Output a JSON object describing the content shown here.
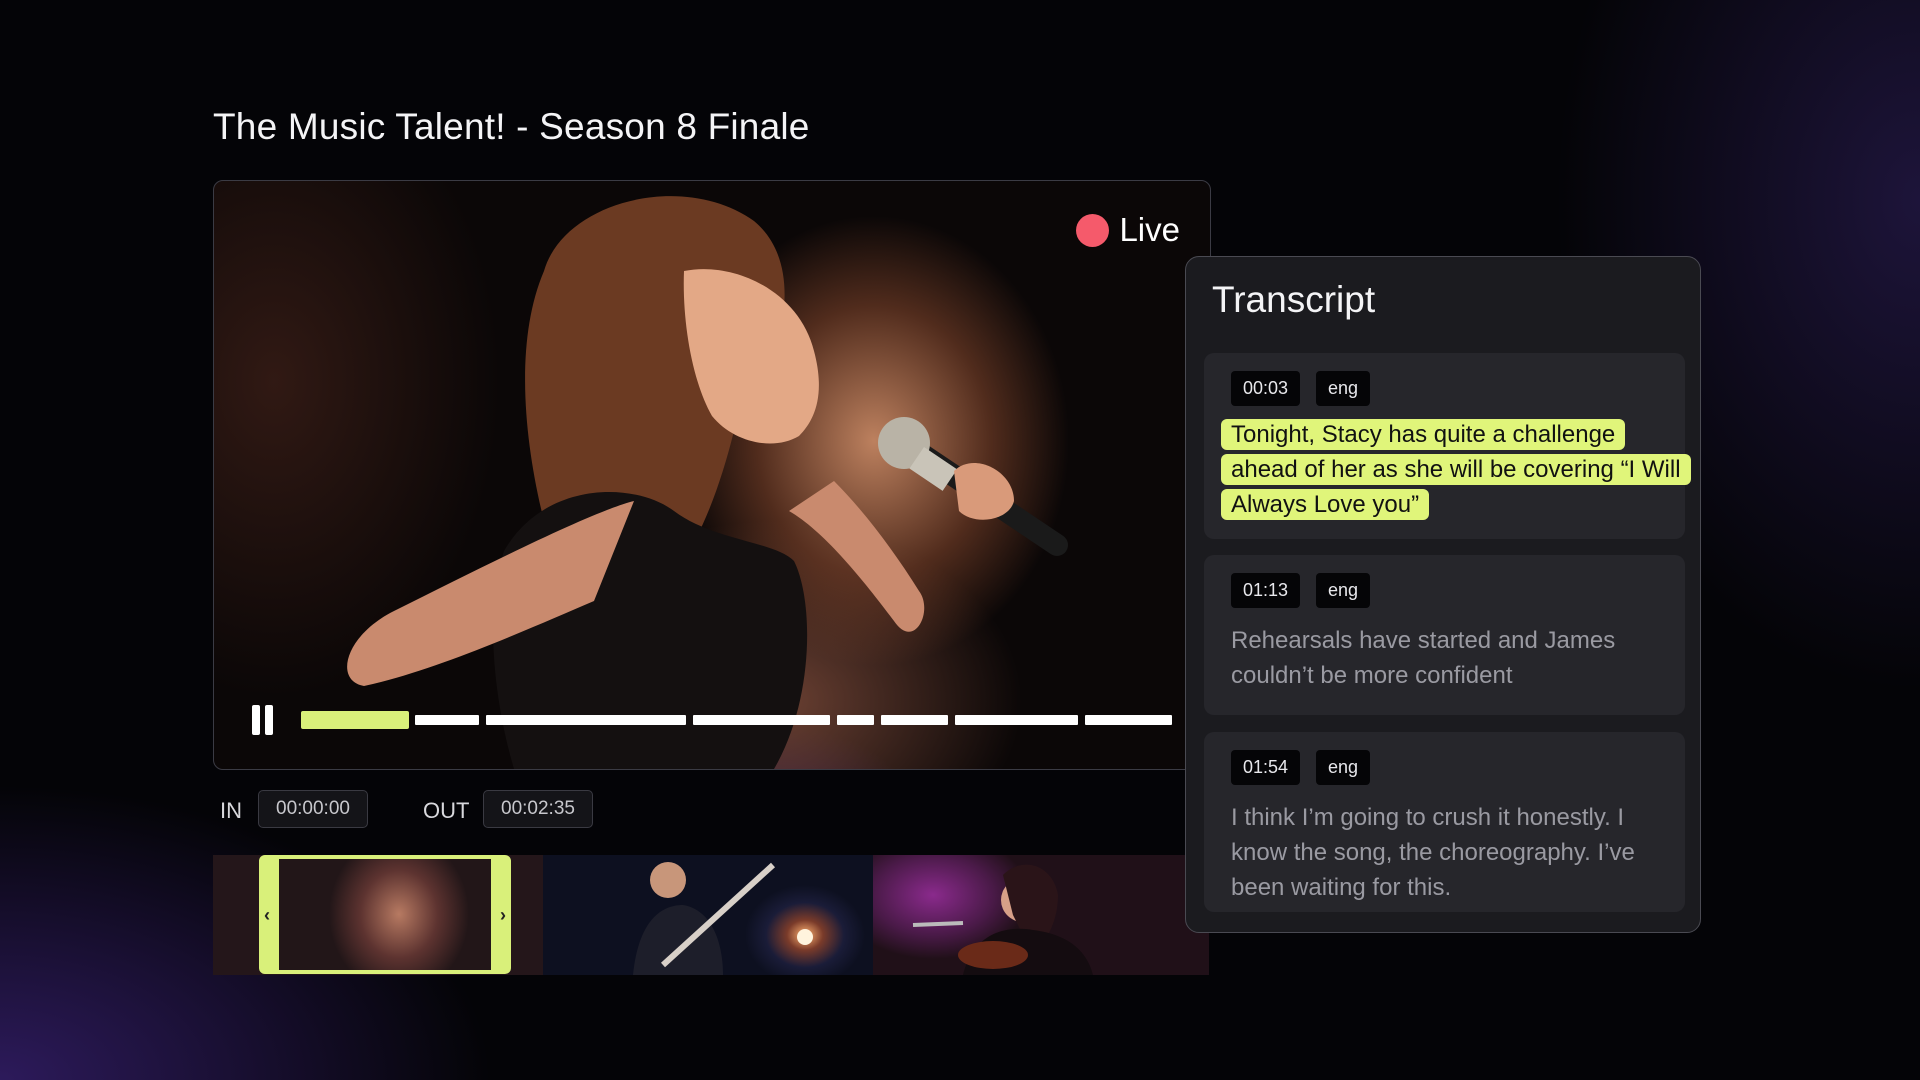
{
  "page": {
    "title": "The Music Talent! - Season 8 Finale"
  },
  "player": {
    "live_label": "Live",
    "progress": 0.12
  },
  "in_out": {
    "in_label": "IN",
    "in_value": "00:00:00",
    "out_label": "OUT",
    "out_value": "00:02:35"
  },
  "filmstrip": {
    "selected_index": 0,
    "prev_icon": "‹",
    "next_icon": "›"
  },
  "transcript": {
    "title": "Transcript",
    "entries": [
      {
        "time": "00:03",
        "lang": "eng",
        "text": "Tonight, Stacy has quite a challenge ahead of her as she will be covering “I Will Always Love you”",
        "active": true
      },
      {
        "time": "01:13",
        "lang": "eng",
        "text": "Rehearsals have started and James couldn’t be more confident",
        "active": false
      },
      {
        "time": "01:54",
        "lang": "eng",
        "text": "I think I’m going to crush it honestly. I know the song, the choreography. I’ve been waiting for this.",
        "active": false
      }
    ]
  },
  "colors": {
    "accent": "#d9f07a",
    "live": "#f55a6b",
    "panel": "#1b1b1f"
  }
}
